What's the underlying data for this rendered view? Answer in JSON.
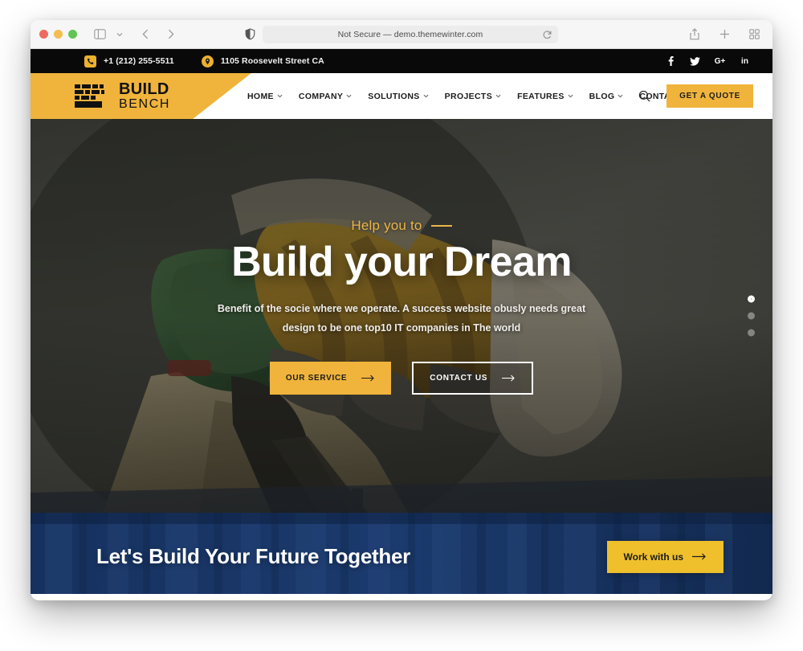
{
  "browser": {
    "url_text": "Not Secure — demo.themewinter.com",
    "icons": {
      "sidebar": "sidebar-icon",
      "back": "back-arrow-icon",
      "forward": "forward-arrow-icon",
      "shield": "shield-icon",
      "reload": "reload-icon",
      "share": "share-icon",
      "new_tab": "plus-icon",
      "tab_overview": "tab-overview-icon"
    }
  },
  "topbar": {
    "phone": "+1 (212) 255-5511",
    "address": "1105 Roosevelt Street CA",
    "phone_icon": "phone-icon",
    "location_icon": "location-pin-icon",
    "socials": [
      {
        "name": "facebook",
        "glyph": "f"
      },
      {
        "name": "twitter",
        "glyph": "t"
      },
      {
        "name": "google-plus",
        "glyph": "G+"
      },
      {
        "name": "linkedin",
        "glyph": "in"
      }
    ]
  },
  "header": {
    "logo": {
      "line1": "BUILD",
      "line2": "BENCH",
      "icon": "brick-logo-icon"
    },
    "nav": [
      {
        "label": "HOME",
        "has_dropdown": true
      },
      {
        "label": "COMPANY",
        "has_dropdown": true
      },
      {
        "label": "SOLUTIONS",
        "has_dropdown": true
      },
      {
        "label": "PROJECTS",
        "has_dropdown": true
      },
      {
        "label": "FEATURES",
        "has_dropdown": true
      },
      {
        "label": "BLOG",
        "has_dropdown": true
      },
      {
        "label": "CONTACT",
        "has_dropdown": true
      }
    ],
    "search_icon": "search-icon",
    "quote_button": "GET A QUOTE"
  },
  "hero": {
    "eyebrow": "Help you to",
    "title": "Build your Dream",
    "subtitle": "Benefit of the socie where we operate. A success website obusly needs great design to be one top10 IT companies in The world",
    "primary_button": "OUR SERVICE",
    "secondary_button": "CONTACT US",
    "slider_dots": 3,
    "active_dot": 1
  },
  "band": {
    "title": "Let's Build Your Future Together",
    "button": "Work with us"
  },
  "colors": {
    "brand_yellow": "#f0b43c",
    "band_yellow": "#f0c02c",
    "band_blue": "#16315f",
    "topbar_black": "#090909",
    "eyebrow_gold": "#eab64a"
  }
}
